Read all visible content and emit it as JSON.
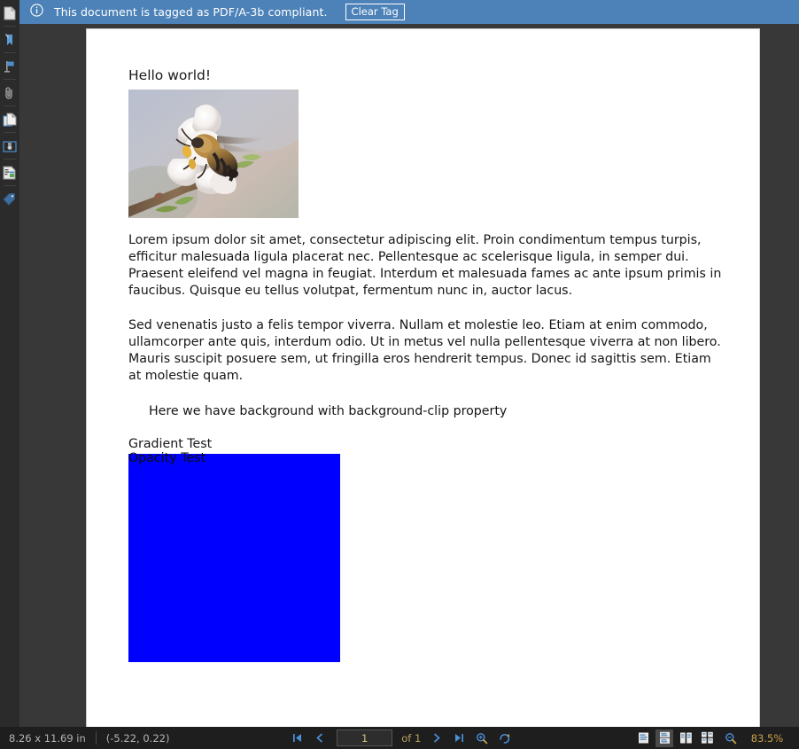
{
  "banner": {
    "icon": "info-circle-icon",
    "message": "This document is tagged as PDF/A-3b compliant.",
    "clear_tag_label": "Clear Tag",
    "background_color": "#4d82b8"
  },
  "sidebar": {
    "items": [
      {
        "name": "pages-thumbnail-icon",
        "title": "Pages"
      },
      {
        "name": "bookmark-ribbon-icon",
        "title": "Bookmarks"
      },
      {
        "name": "flag-marker-icon",
        "title": "Annotations"
      },
      {
        "name": "paperclip-attachment-icon",
        "title": "Attachments"
      },
      {
        "name": "layers-copy-icon",
        "title": "Layers"
      },
      {
        "name": "signature-stamp-icon",
        "title": "Signatures"
      },
      {
        "name": "form-fields-icon",
        "title": "Form Fields"
      },
      {
        "name": "tags-label-icon",
        "title": "Tags"
      }
    ]
  },
  "document": {
    "heading": "Hello world!",
    "image_alt": "Photo of a bee on a white flower blossom",
    "paragraph_1": "Lorem ipsum dolor sit amet, consectetur adipiscing elit. Proin condimentum tempus turpis, efficitur malesuada ligula placerat nec. Pellentesque ac scelerisque ligula, in semper dui. Praesent eleifend vel magna in feugiat. Interdum et malesuada fames ac ante ipsum primis in faucibus. Quisque eu tellus volutpat, fermentum nunc in, auctor lacus.",
    "paragraph_2": "Sed venenatis justo a felis tempor viverra. Nullam et molestie leo. Etiam at enim commodo, ullamcorper ante quis, interdum odio. Ut in metus vel nulla pellentesque viverra at non libero. Mauris suscipit posuere sem, ut fringilla eros hendrerit tempus. Donec id sagittis sem. Etiam at molestie quam.",
    "background_clip_text": "Here we have background with background-clip property",
    "gradient_test_label": "Gradient Test",
    "opacity_test_label": "Opacity Test",
    "box_color": "#0000ff"
  },
  "statusbar": {
    "page_dimensions": "8.26 x 11.69 in",
    "cursor_position": "(-5.22, 0.22)",
    "nav": {
      "first_page_icon": "first-page-icon",
      "previous_page_icon": "previous-page-icon",
      "page_number": "1",
      "page_count_label": "of 1",
      "next_page_icon": "next-page-icon",
      "last_page_icon": "last-page-icon",
      "zoom_in_icon": "zoom-in-icon",
      "rotate_icon": "rotate-view-icon"
    },
    "view_modes": [
      {
        "name": "single-page-view",
        "active": false
      },
      {
        "name": "continuous-scroll-view",
        "active": true
      },
      {
        "name": "two-page-view",
        "active": false
      },
      {
        "name": "two-page-cover-view",
        "active": false
      }
    ],
    "zoom_out_icon": "zoom-out-icon",
    "zoom_level": "83.5%"
  }
}
